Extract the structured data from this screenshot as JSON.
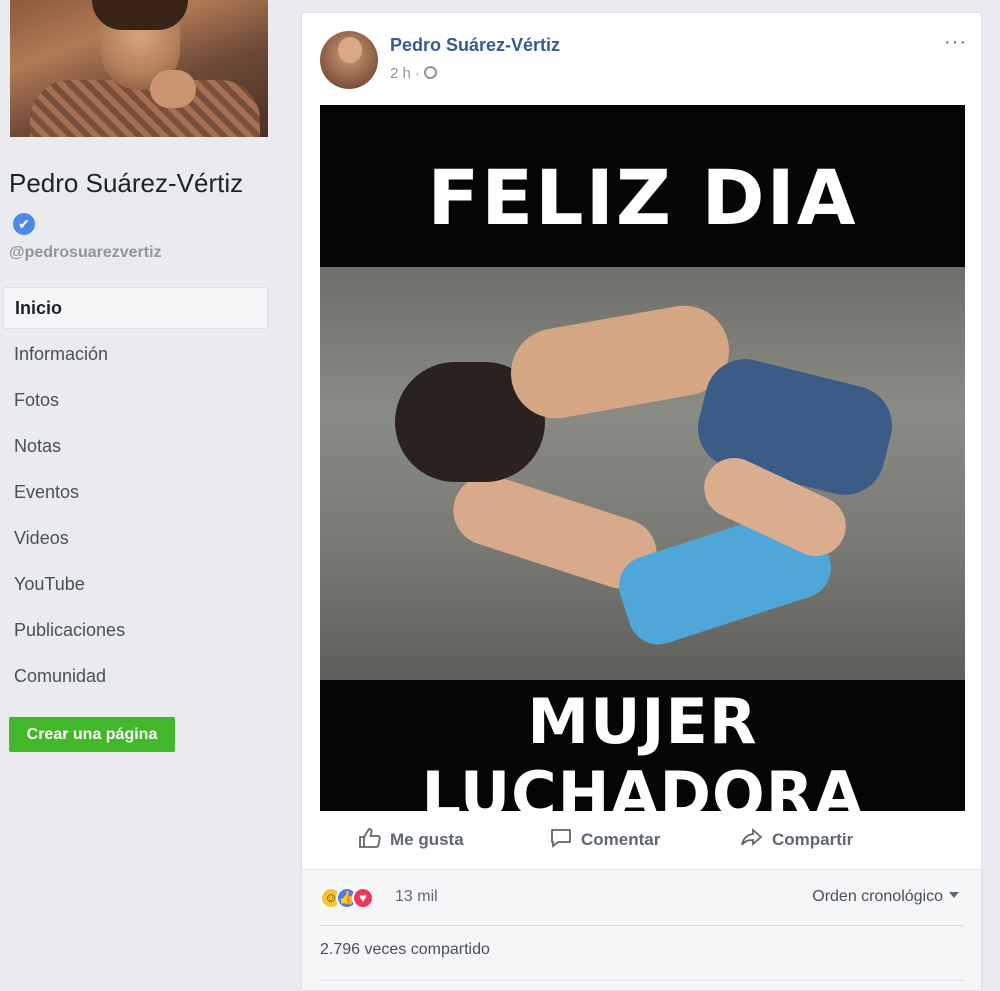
{
  "sidebar": {
    "page_name": "Pedro Suárez-Vértiz",
    "verified_icon": "✔",
    "handle": "@pedrosuarezvertiz",
    "nav_items": [
      {
        "label": "Inicio",
        "active": true
      },
      {
        "label": "Información"
      },
      {
        "label": "Fotos"
      },
      {
        "label": "Notas"
      },
      {
        "label": "Eventos"
      },
      {
        "label": "Videos"
      },
      {
        "label": "YouTube"
      },
      {
        "label": "Publicaciones"
      },
      {
        "label": "Comunidad"
      }
    ],
    "create_page_label": "Crear una página"
  },
  "post": {
    "author": "Pedro Suárez-Vértiz",
    "time": "2 h",
    "meta_sep": "·",
    "more_label": "···",
    "image_text_top": "FELIZ DIA",
    "image_text_bottom": "MUJER LUCHADORA",
    "actions": {
      "like": "Me gusta",
      "comment": "Comentar",
      "share": "Compartir"
    },
    "reactions": {
      "icons": [
        "haha-icon",
        "like-icon",
        "love-icon"
      ],
      "count": "13 mil"
    },
    "order_label": "Orden cronológico",
    "shares": "2.796 veces compartido"
  },
  "colors": {
    "link_blue": "#385898",
    "create_green": "#42b72a",
    "verified_blue": "#4b88e8"
  }
}
